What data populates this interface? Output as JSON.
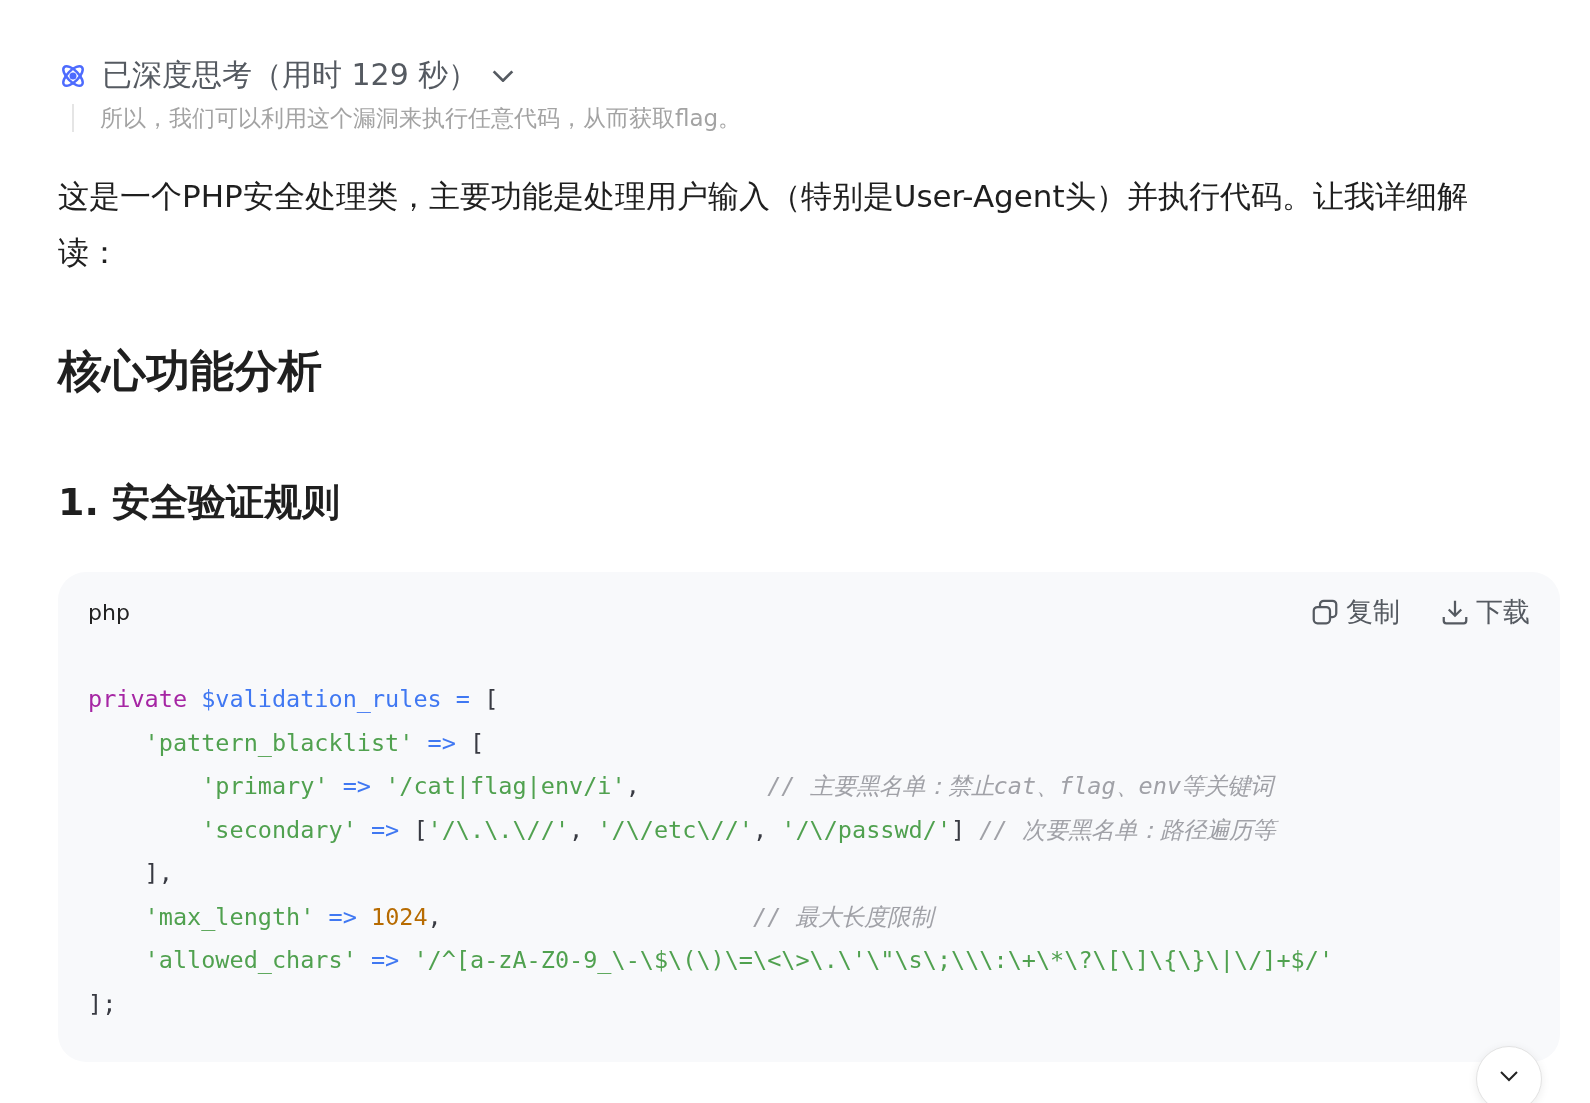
{
  "thinking": {
    "label": "已深度思考（用时 129 秒）",
    "expanded": false,
    "faded_text": "所以，我们可以利用这个漏洞来执行任意代码，从而获取flag。"
  },
  "intro": "这是一个PHP安全处理类，主要功能是处理用户输入（特别是User-Agent头）并执行代码。让我详细解读：",
  "heading": "核心功能分析",
  "subheading": "1. 安全验证规则",
  "code_block": {
    "language": "php",
    "copy_label": "复制",
    "download_label": "下载",
    "lines": [
      [
        {
          "kind": "keyword",
          "text": "private "
        },
        {
          "kind": "variable",
          "text": "$validation_rules "
        },
        {
          "kind": "operator",
          "text": "="
        },
        {
          "kind": "plain",
          "text": " ["
        }
      ],
      [
        {
          "kind": "string",
          "text": "    'pattern_blacklist' "
        },
        {
          "kind": "operator",
          "text": "=>"
        },
        {
          "kind": "plain",
          "text": " ["
        }
      ],
      [
        {
          "kind": "string",
          "text": "        'primary' "
        },
        {
          "kind": "operator",
          "text": "=> "
        },
        {
          "kind": "string",
          "text": "'/cat|flag|env/i'"
        },
        {
          "kind": "plain",
          "text": ",         "
        },
        {
          "kind": "comment",
          "text": "// 主要黑名单：禁止cat、flag、env等关键词"
        }
      ],
      [
        {
          "kind": "string",
          "text": "        'secondary' "
        },
        {
          "kind": "operator",
          "text": "=>"
        },
        {
          "kind": "plain",
          "text": " ["
        },
        {
          "kind": "string",
          "text": "'/\\.\\.\\//'"
        },
        {
          "kind": "plain",
          "text": ", "
        },
        {
          "kind": "string",
          "text": "'/\\/etc\\//'"
        },
        {
          "kind": "plain",
          "text": ", "
        },
        {
          "kind": "string",
          "text": "'/\\/passwd/'"
        },
        {
          "kind": "plain",
          "text": "] "
        },
        {
          "kind": "comment",
          "text": "// 次要黑名单：路径遍历等"
        }
      ],
      [
        {
          "kind": "plain",
          "text": "    ],"
        }
      ],
      [
        {
          "kind": "string",
          "text": "    'max_length' "
        },
        {
          "kind": "operator",
          "text": "=> "
        },
        {
          "kind": "number",
          "text": "1024"
        },
        {
          "kind": "plain",
          "text": ",                      "
        },
        {
          "kind": "comment",
          "text": "// 最大长度限制"
        }
      ],
      [
        {
          "kind": "string",
          "text": "    'allowed_chars' "
        },
        {
          "kind": "operator",
          "text": "=> "
        },
        {
          "kind": "string",
          "text": "'/^[a-zA-Z0-9_\\-\\$\\(\\)\\=\\<\\>\\.\\'\\\"\\s\\;\\\\\\:\\+\\*\\?\\[\\]\\{\\}\\|\\/]+$/'"
        }
      ],
      [
        {
          "kind": "plain",
          "text": "];"
        }
      ]
    ]
  }
}
